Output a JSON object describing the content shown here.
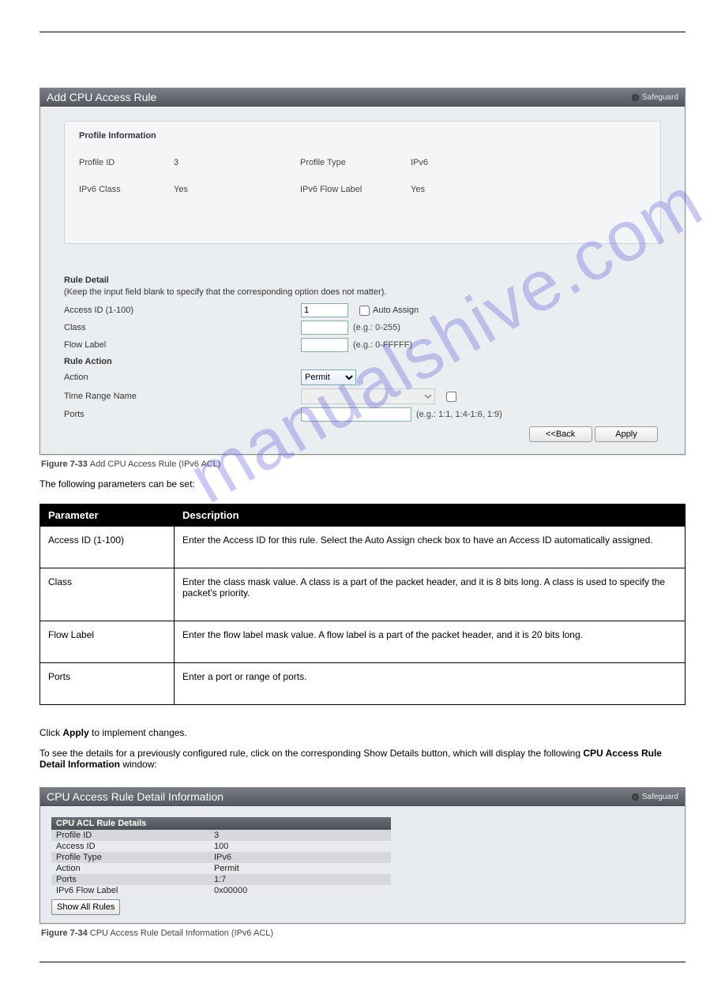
{
  "watermark": "manualshive.com",
  "panel1": {
    "title": "Add CPU Access Rule",
    "safeguard": "Safeguard",
    "profile_info_title": "Profile Information",
    "profile_id_label": "Profile ID",
    "profile_id_value": "3",
    "profile_type_label": "Profile Type",
    "profile_type_value": "IPv6",
    "ipv6_class_label": "IPv6 Class",
    "ipv6_class_value": "Yes",
    "ipv6_flow_label": "IPv6 Flow Label",
    "ipv6_flow_value": "Yes",
    "rule_detail_title": "Rule Detail",
    "keep_note": "(Keep the input field blank to specify that the corresponding option does not matter).",
    "access_id_label": "Access ID (1-100)",
    "access_id_value": "1",
    "auto_assign_label": "Auto Assign",
    "class_label": "Class",
    "class_hint": "(e.g.: 0-255)",
    "flow_label_label": "Flow Label",
    "flow_hint": "(e.g.: 0-FFFFF)",
    "rule_action_title": "Rule Action",
    "action_label": "Action",
    "action_value": "Permit",
    "time_range_label": "Time Range Name",
    "ports_label": "Ports",
    "ports_hint": "(e.g.: 1:1, 1:4-1:6, 1:9)",
    "back_btn": "<<Back",
    "apply_btn": "Apply"
  },
  "figure1": {
    "prefix": "Figure 7-33 ",
    "text": "Add CPU Access Rule (IPv6 ACL)"
  },
  "params_intro": "The following parameters can be set:",
  "params_table": {
    "h1": "Parameter",
    "h2": "Description",
    "rows": [
      {
        "name": "Access ID (1-100)",
        "desc": "Enter the Access ID for this rule. Select the Auto Assign check box to have an Access ID automatically assigned."
      },
      {
        "name": "Class",
        "desc": "Enter the class mask value. A class is a part of the packet header, and it is 8 bits long. A class is used to specify the packet's priority."
      },
      {
        "name": "Flow Label",
        "desc": "Enter the flow label mask value. A flow label is a part of the packet header, and it is 20 bits long."
      },
      {
        "name": "Ports",
        "desc": "Enter a port or range of ports."
      }
    ]
  },
  "apply_note1": "Click ",
  "apply_note_bold": "Apply",
  "apply_note2": " to implement changes.",
  "detail_intro": {
    "pre": "To see the details for a previously configured rule, click on the corresponding Show Details button, which will display the following ",
    "bold": "CPU Access Rule Detail Information",
    "post": " window:"
  },
  "panel2": {
    "title": "CPU Access Rule Detail Information",
    "safeguard": "Safeguard",
    "subhead": "CPU ACL Rule Details",
    "rows": [
      {
        "k": "Profile ID",
        "v": "3"
      },
      {
        "k": "Access ID",
        "v": "100"
      },
      {
        "k": "Profile Type",
        "v": "IPv6"
      },
      {
        "k": "Action",
        "v": "Permit"
      },
      {
        "k": "Ports",
        "v": "1:7"
      },
      {
        "k": "IPv6 Flow Label",
        "v": "0x00000"
      }
    ],
    "show_all": "Show All Rules"
  },
  "figure2": {
    "prefix": "Figure 7-34 ",
    "text": "CPU Access Rule Detail Information (IPv6 ACL)"
  }
}
